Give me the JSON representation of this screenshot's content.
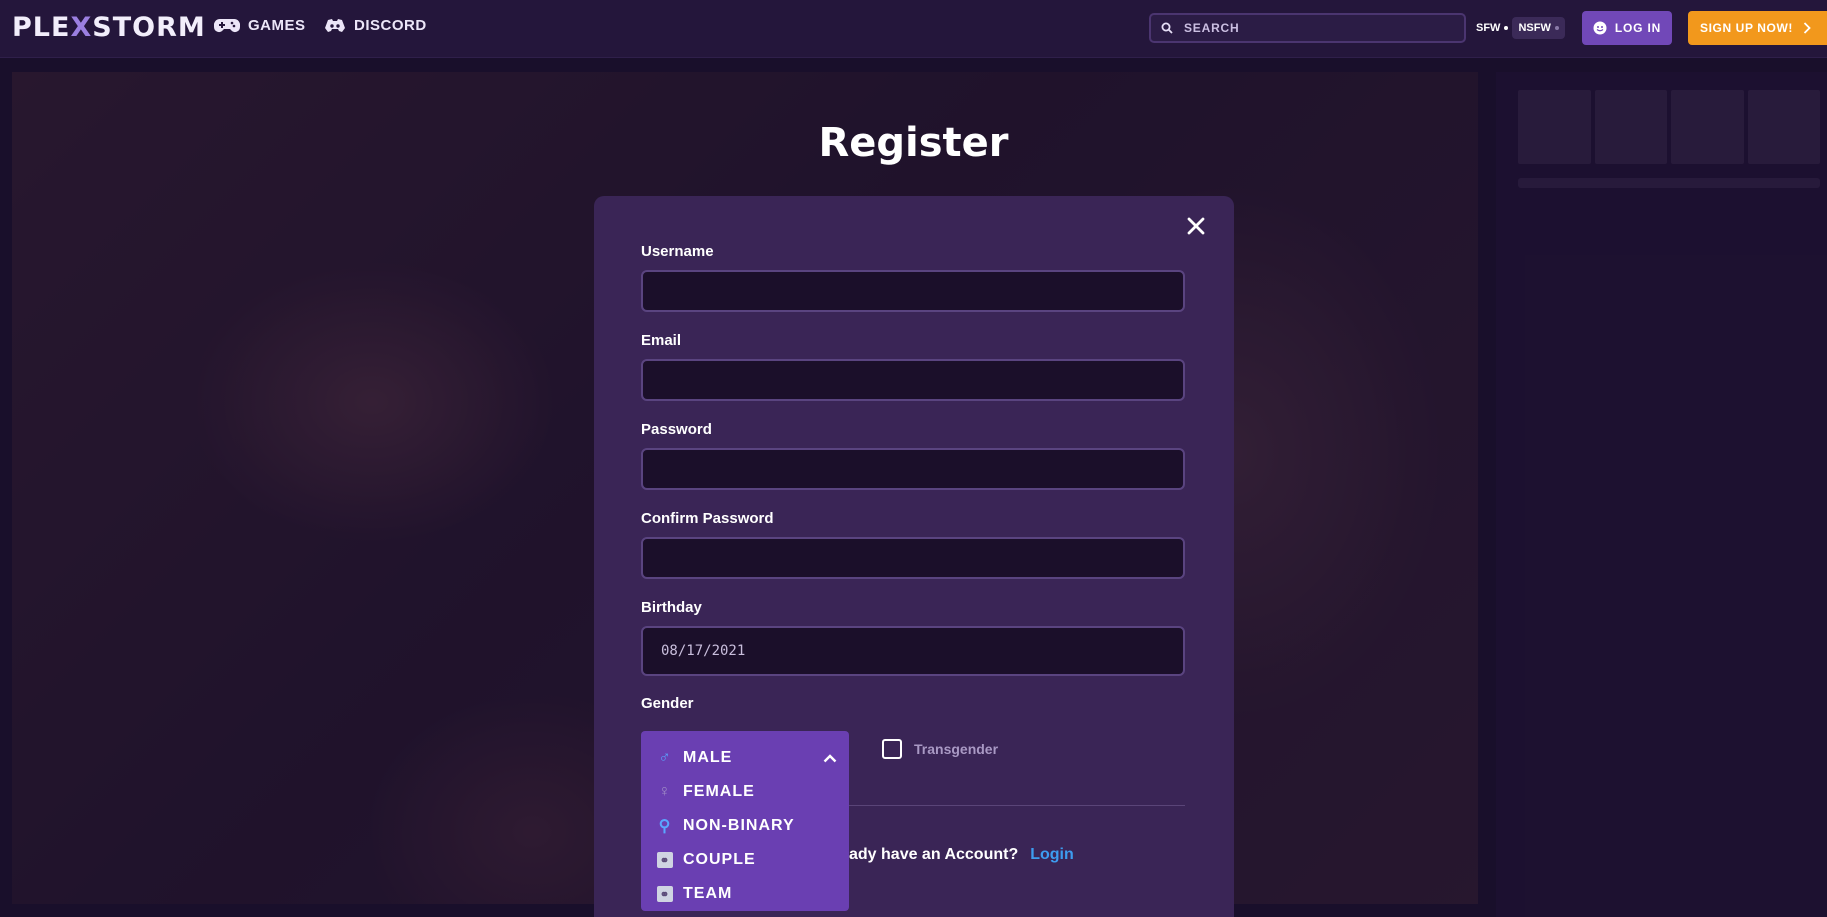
{
  "brand": {
    "logo_left": "PLE",
    "logo_x": "X",
    "logo_right": "STORM"
  },
  "nav": {
    "games_label": "GAMES",
    "discord_label": "DISCORD",
    "search_placeholder": "SEARCH",
    "sfw_label": "SFW",
    "nsfw_label": "NSFW",
    "login_label": "LOG IN",
    "signup_label": "SIGN UP NOW!"
  },
  "page": {
    "title": "Register"
  },
  "form": {
    "username_label": "Username",
    "email_label": "Email",
    "password_label": "Password",
    "confirm_password_label": "Confirm Password",
    "birthday_label": "Birthday",
    "birthday_value": "08/17/2021",
    "gender_label": "Gender",
    "gender_options": [
      {
        "label": "MALE",
        "icon": "male-icon",
        "selected": true
      },
      {
        "label": "FEMALE",
        "icon": "female-icon"
      },
      {
        "label": "NON-BINARY",
        "icon": "non-binary-icon"
      },
      {
        "label": "COUPLE",
        "icon": "couple-icon"
      },
      {
        "label": "TEAM",
        "icon": "team-icon"
      }
    ],
    "transgender_label": "Transgender",
    "account_prompt": "ady have an Account?",
    "login_link": "Login"
  },
  "colors": {
    "accent_purple": "#7148b8",
    "signup_orange": "#f2981c",
    "link_blue": "#3d9cf0",
    "modal_bg": "#3a2556"
  }
}
